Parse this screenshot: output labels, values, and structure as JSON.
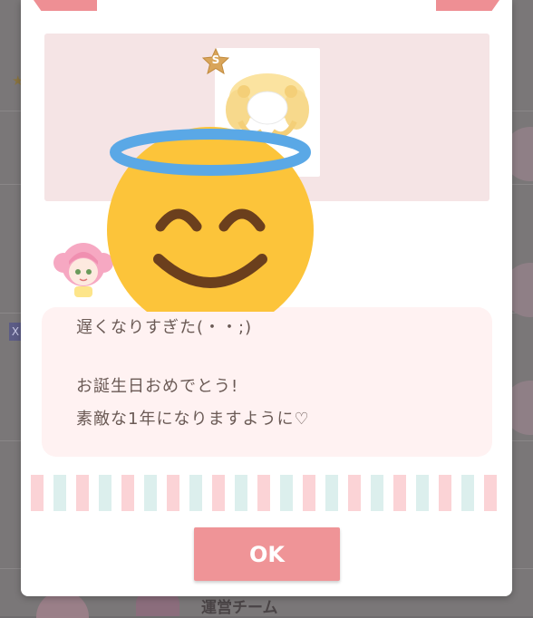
{
  "background": {
    "footer_name": "運営チーム",
    "x_badge": "X"
  },
  "gift": {
    "badge_letter": "S"
  },
  "message": {
    "line1": "遅くなりすぎた(・・;)",
    "line2": "",
    "line3": "お誕生日おめでとう!",
    "line4": "素敵な1年になりますように♡"
  },
  "buttons": {
    "ok_label": "OK"
  },
  "colors": {
    "accent_pink": "#ef9497",
    "gift_area": "#f5e4e5",
    "message_bg": "#fff2f2",
    "stripe_pink": "#fbd3d6",
    "stripe_mint": "#dcefed",
    "emoji_yellow": "#fcc43a",
    "halo_blue": "#5aa8e6"
  },
  "icons": [
    "star-badge-icon",
    "hair-accessory-icon",
    "avatar-icon",
    "smiling-face-with-halo-icon"
  ]
}
